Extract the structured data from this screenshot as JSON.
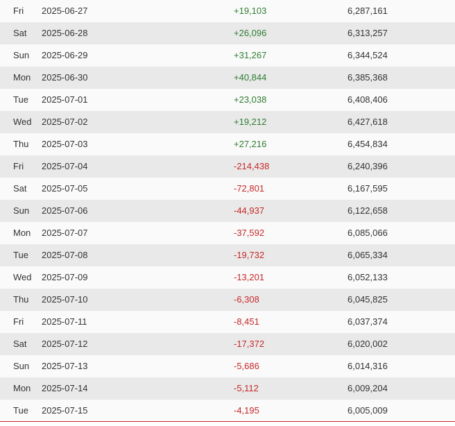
{
  "colors": {
    "row_light": "#fafafa",
    "row_dark": "#e9e9e9",
    "positive": "#2e7d32",
    "negative": "#c62828",
    "text": "#333333"
  },
  "rows": [
    {
      "day": "Fri",
      "date": "2025-06-27",
      "change": "+19,103",
      "total": "6,287,161"
    },
    {
      "day": "Sat",
      "date": "2025-06-28",
      "change": "+26,096",
      "total": "6,313,257"
    },
    {
      "day": "Sun",
      "date": "2025-06-29",
      "change": "+31,267",
      "total": "6,344,524"
    },
    {
      "day": "Mon",
      "date": "2025-06-30",
      "change": "+40,844",
      "total": "6,385,368"
    },
    {
      "day": "Tue",
      "date": "2025-07-01",
      "change": "+23,038",
      "total": "6,408,406"
    },
    {
      "day": "Wed",
      "date": "2025-07-02",
      "change": "+19,212",
      "total": "6,427,618"
    },
    {
      "day": "Thu",
      "date": "2025-07-03",
      "change": "+27,216",
      "total": "6,454,834"
    },
    {
      "day": "Fri",
      "date": "2025-07-04",
      "change": "-214,438",
      "total": "6,240,396"
    },
    {
      "day": "Sat",
      "date": "2025-07-05",
      "change": "-72,801",
      "total": "6,167,595"
    },
    {
      "day": "Sun",
      "date": "2025-07-06",
      "change": "-44,937",
      "total": "6,122,658"
    },
    {
      "day": "Mon",
      "date": "2025-07-07",
      "change": "-37,592",
      "total": "6,085,066"
    },
    {
      "day": "Tue",
      "date": "2025-07-08",
      "change": "-19,732",
      "total": "6,065,334"
    },
    {
      "day": "Wed",
      "date": "2025-07-09",
      "change": "-13,201",
      "total": "6,052,133"
    },
    {
      "day": "Thu",
      "date": "2025-07-10",
      "change": "-6,308",
      "total": "6,045,825"
    },
    {
      "day": "Fri",
      "date": "2025-07-11",
      "change": "-8,451",
      "total": "6,037,374"
    },
    {
      "day": "Sat",
      "date": "2025-07-12",
      "change": "-17,372",
      "total": "6,020,002"
    },
    {
      "day": "Sun",
      "date": "2025-07-13",
      "change": "-5,686",
      "total": "6,014,316"
    },
    {
      "day": "Mon",
      "date": "2025-07-14",
      "change": "-5,112",
      "total": "6,009,204"
    },
    {
      "day": "Tue",
      "date": "2025-07-15",
      "change": "-4,195",
      "total": "6,005,009"
    }
  ]
}
